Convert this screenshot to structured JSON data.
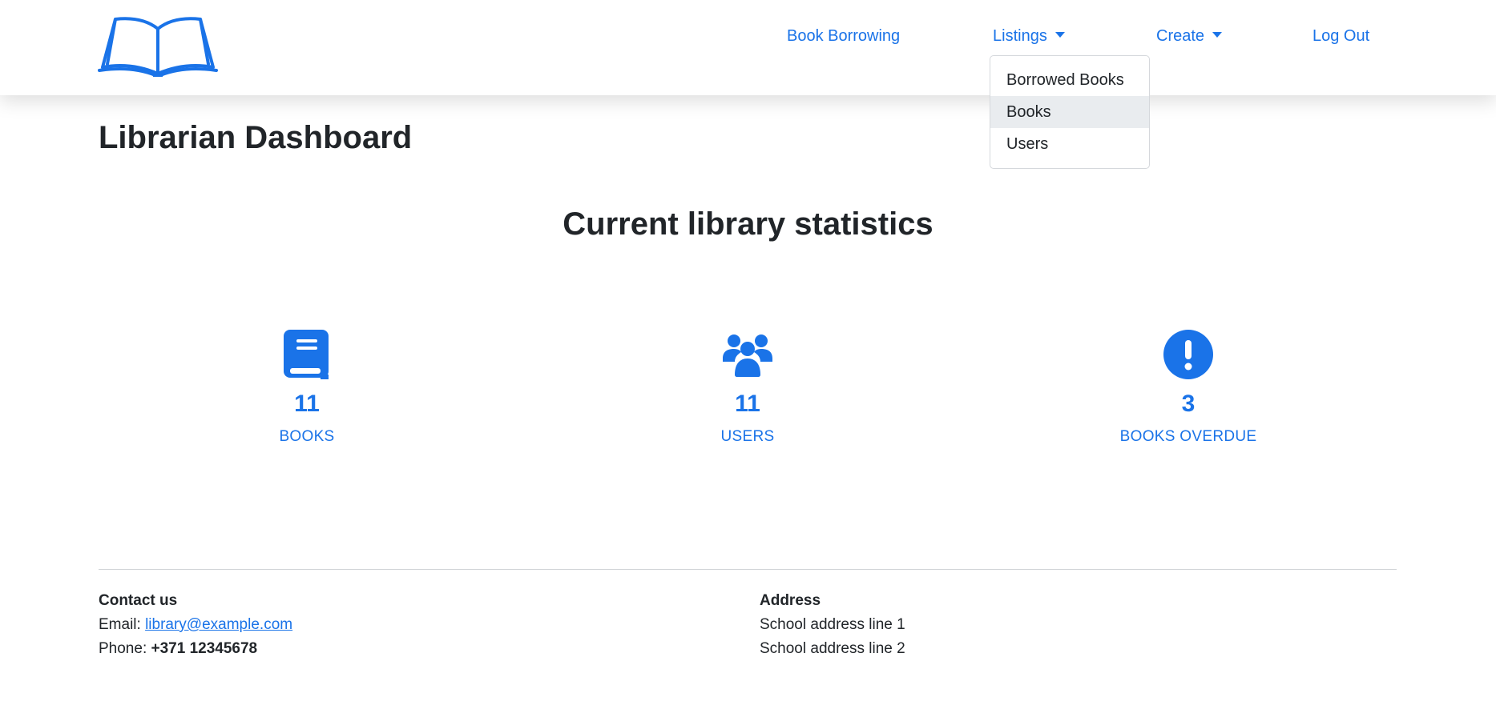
{
  "nav": {
    "logo_icon": "open-book-icon",
    "links": {
      "book_borrowing": "Book Borrowing",
      "listings": "Listings",
      "create": "Create",
      "log_out": "Log Out"
    },
    "listings_menu": {
      "items": [
        "Borrowed Books",
        "Books",
        "Users"
      ],
      "highlighted": "Books"
    }
  },
  "page": {
    "title": "Librarian Dashboard",
    "section_title": "Current library statistics"
  },
  "stats": [
    {
      "icon": "book-icon",
      "value": "11",
      "label": "BOOKS"
    },
    {
      "icon": "users-icon",
      "value": "11",
      "label": "USERS"
    },
    {
      "icon": "exclamation-circle-icon",
      "value": "3",
      "label": "BOOKS OVERDUE"
    }
  ],
  "footer": {
    "contact": {
      "heading": "Contact us",
      "email_label": "Email:",
      "email": "library@example.com",
      "phone_label": "Phone:",
      "phone": "+371 12345678"
    },
    "address": {
      "heading": "Address",
      "line1": "School address line 1",
      "line2": "School address line 2"
    }
  },
  "colors": {
    "accent": "#1a73e8",
    "text": "#212529",
    "menu_highlight": "#e9ecef"
  }
}
